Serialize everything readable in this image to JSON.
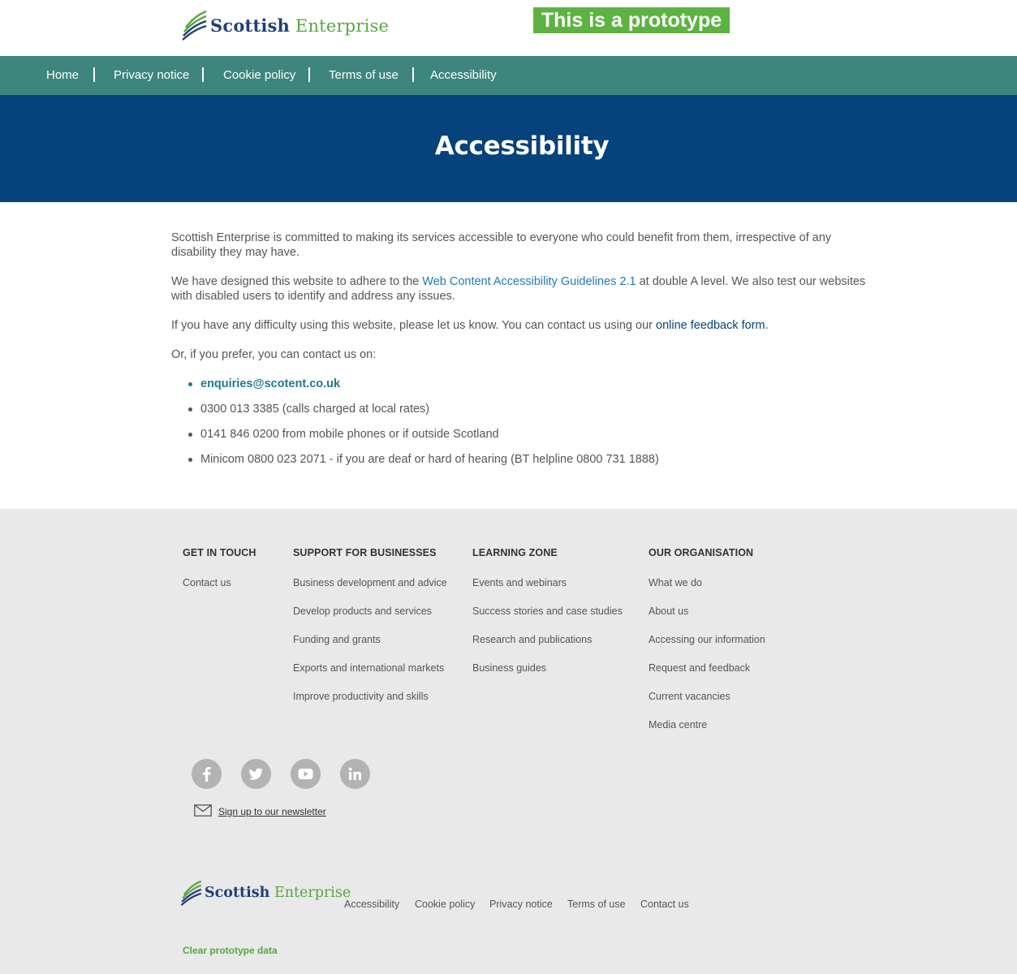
{
  "header": {
    "logo_word1": "Scottish",
    "logo_word2": "Enterprise",
    "prototype_banner": "This is a prototype"
  },
  "nav": {
    "items": [
      {
        "label": "Home"
      },
      {
        "label": "Privacy notice"
      },
      {
        "label": "Cookie policy"
      },
      {
        "label": "Terms of use"
      },
      {
        "label": "Accessibility"
      }
    ]
  },
  "hero": {
    "title": "Accessibility"
  },
  "content": {
    "p1": "Scottish Enterprise is committed to making its services accessible to everyone who could benefit from them, irrespective of any disability they may have.",
    "p2_before": "We have designed this website to adhere to the ",
    "p2_link": "Web Content Accessibility Guidelines 2.1",
    "p2_after": " at double A level. We also test our websites with disabled users to identify and address any issues.",
    "p3_before": "If you have any difficulty using this website, please let us know. You can contact us using our ",
    "p3_link": "online feedback form",
    "p3_after": ".",
    "p4": "Or, if you prefer, you can contact us on:",
    "contacts": {
      "email": "enquiries@scotent.co.uk",
      "phone1": "0300 013 3385 (calls charged at local rates)",
      "phone2": "0141 846 0200 from mobile phones or if outside Scotland",
      "minicom": "Minicom 0800 023 2071 - if you are deaf or hard of hearing (BT helpline 0800 731 1888)"
    }
  },
  "footer": {
    "columns": [
      {
        "heading": "GET IN TOUCH",
        "links": [
          "Contact us"
        ]
      },
      {
        "heading": "SUPPORT FOR BUSINESSES",
        "links": [
          "Business development and advice",
          "Develop products and services",
          "Funding and grants",
          "Exports and international markets",
          "Improve productivity and skills"
        ]
      },
      {
        "heading": "LEARNING ZONE",
        "links": [
          "Events and webinars",
          "Success stories and case studies",
          "Research and publications",
          "Business guides"
        ]
      },
      {
        "heading": "OUR ORGANISATION",
        "links": [
          "What we do",
          "About us",
          "Accessing our information",
          "Request and feedback",
          "Current vacancies",
          "Media centre"
        ]
      }
    ],
    "social_icons": [
      "facebook-icon",
      "twitter-icon",
      "youtube-icon",
      "linkedin-icon"
    ],
    "newsletter": "Sign up to our newsletter",
    "bottom_links": [
      "Accessibility",
      "Cookie policy",
      "Privacy notice",
      "Terms of use",
      "Contact us"
    ],
    "clear_prototype": "Clear prototype data"
  },
  "colors": {
    "nav_bg": "#3e857d",
    "hero_bg": "#06427b",
    "footer_bg": "#e9e9e9",
    "banner_bg": "#5cb342",
    "brand_green": "#57a640",
    "brand_blue": "#1f3f7a"
  }
}
